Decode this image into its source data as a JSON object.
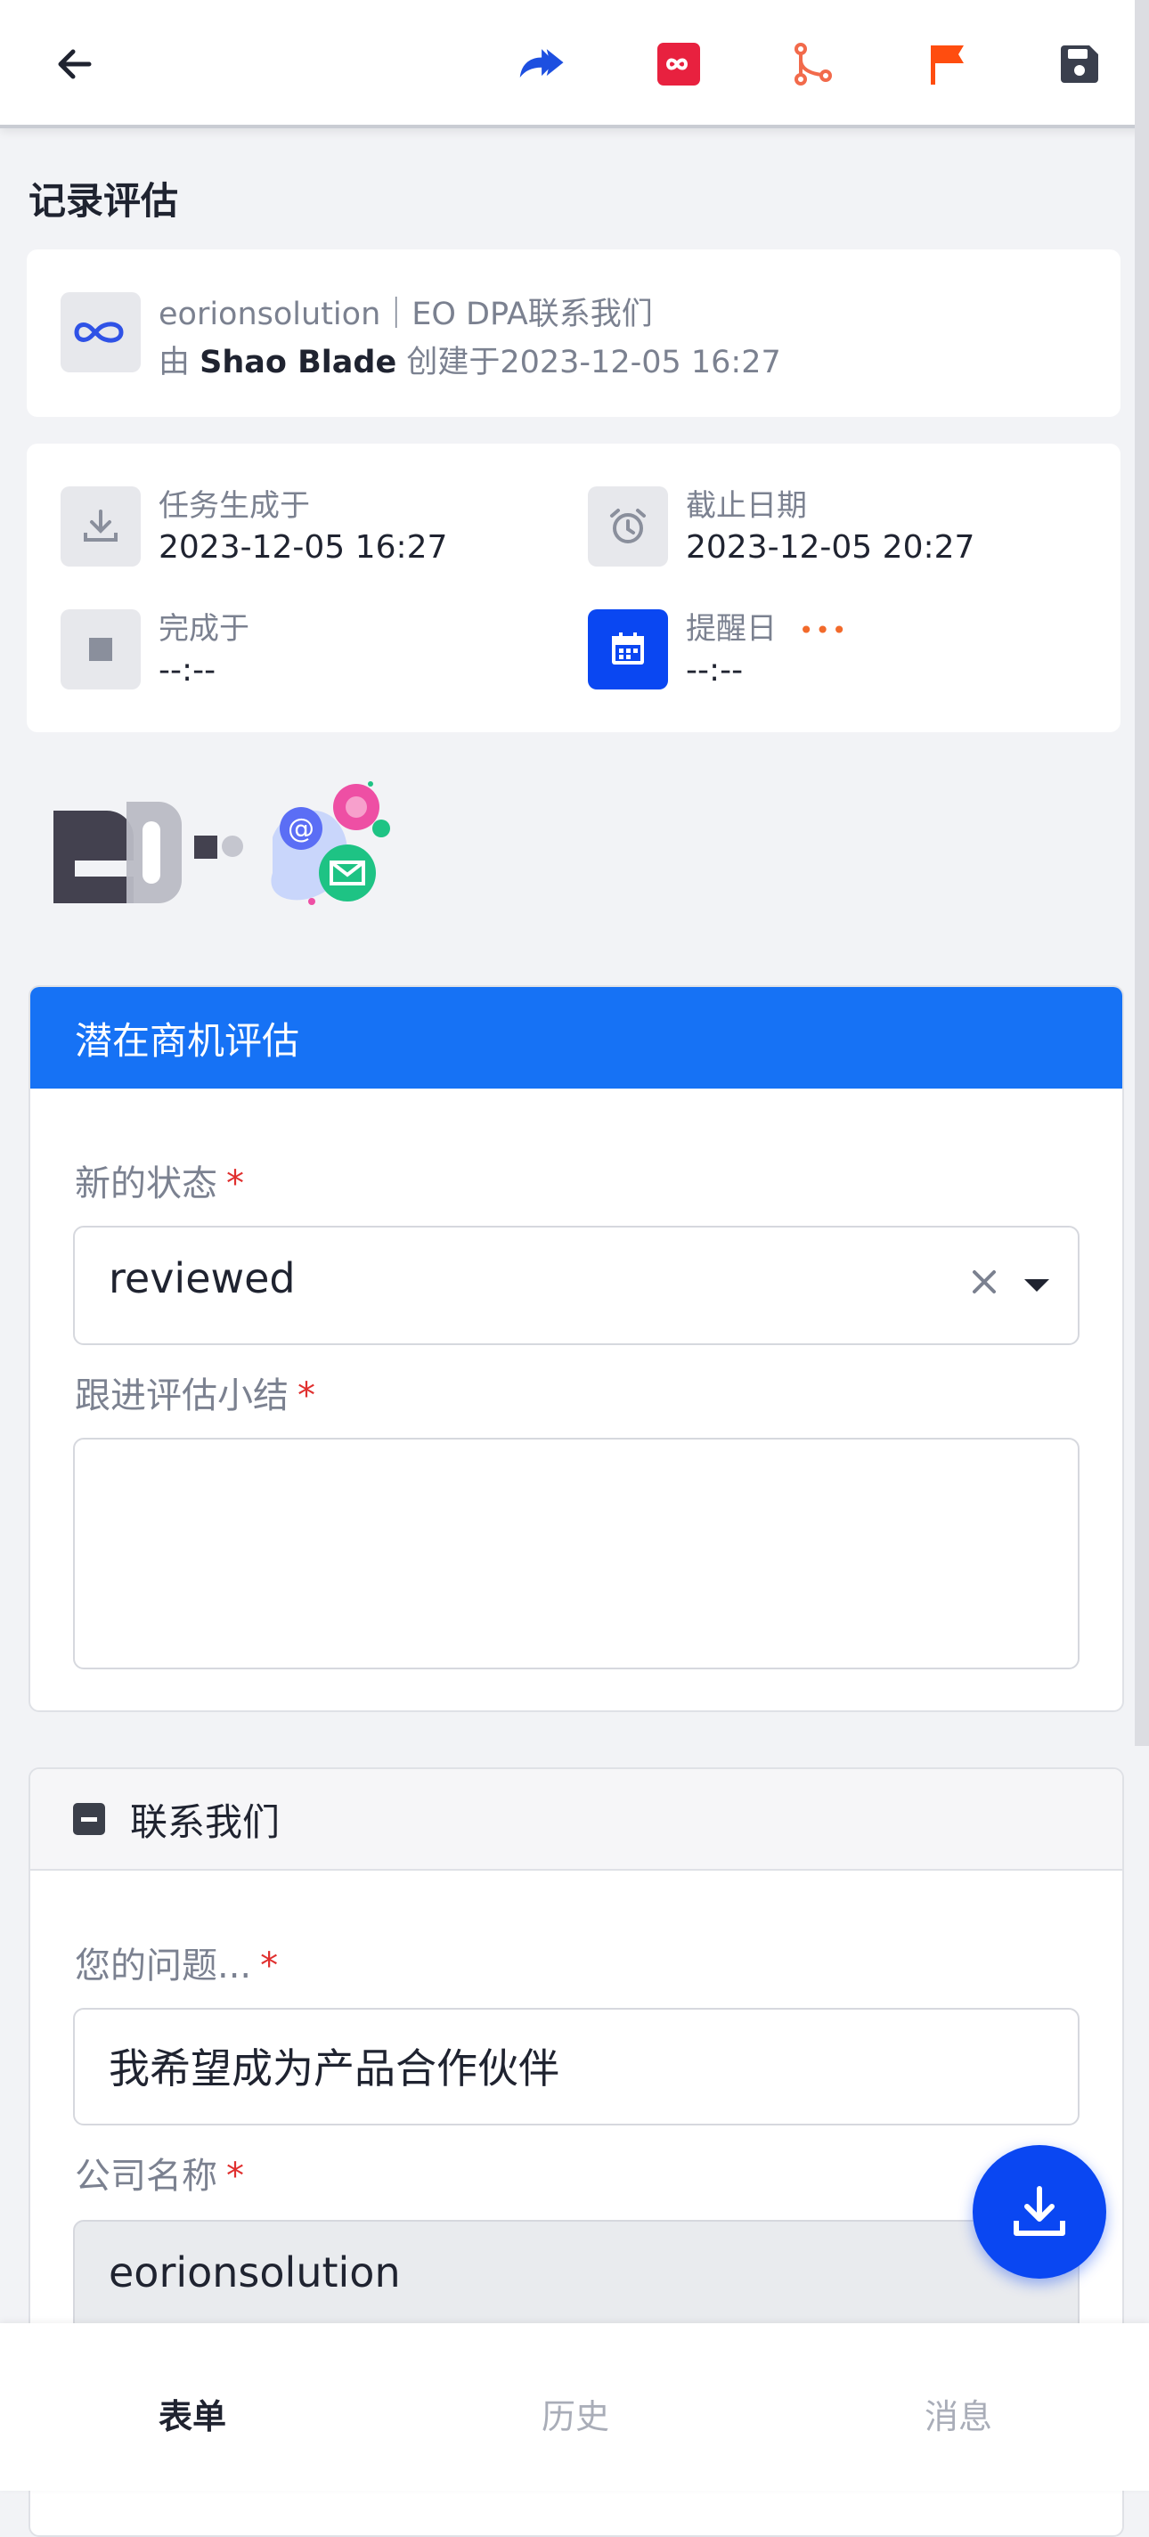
{
  "toolbar": {
    "back_icon": "arrow-left-icon",
    "forward_icon": "double-forward-icon",
    "infinity_icon": "infinity-icon",
    "branch_icon": "branch-icon",
    "flag_icon": "flag-icon",
    "save_icon": "save-icon",
    "colors": {
      "forward": "#1d4fe0",
      "infinity": "#e8213f",
      "branch": "#f26a4b",
      "flag": "#ff4d0f",
      "save": "#3a3f4d"
    }
  },
  "page": {
    "title": "记录评估"
  },
  "record": {
    "source": "eorionsolution｜EO DPA联系我们",
    "by_prefix": "由",
    "creator": "Shao Blade",
    "created_text": "创建于2023-12-05 16:27"
  },
  "task_info": {
    "generated_label": "任务生成于",
    "generated_value": "2023-12-05 16:27",
    "deadline_label": "截止日期",
    "deadline_value": "2023-12-05 20:27",
    "completed_label": "完成于",
    "completed_value": "--:--",
    "reminder_label": "提醒日",
    "reminder_more": "•••",
    "reminder_value": "--:--"
  },
  "form": {
    "header": "潜在商机评估",
    "status_label": "新的状态",
    "status_value": "reviewed",
    "summary_label": "跟进评估小结",
    "required_mark": "*"
  },
  "contact": {
    "header": "联系我们",
    "question_label": "您的问题...",
    "question_value": "我希望成为产品合作伙伴",
    "company_label": "公司名称",
    "company_value": "eorionsolution"
  },
  "bottom_nav": {
    "form": "表单",
    "history": "历史",
    "messages": "消息"
  },
  "colors": {
    "accent": "#1672f5",
    "fab": "#0a47f2",
    "required": "#e0302f"
  }
}
